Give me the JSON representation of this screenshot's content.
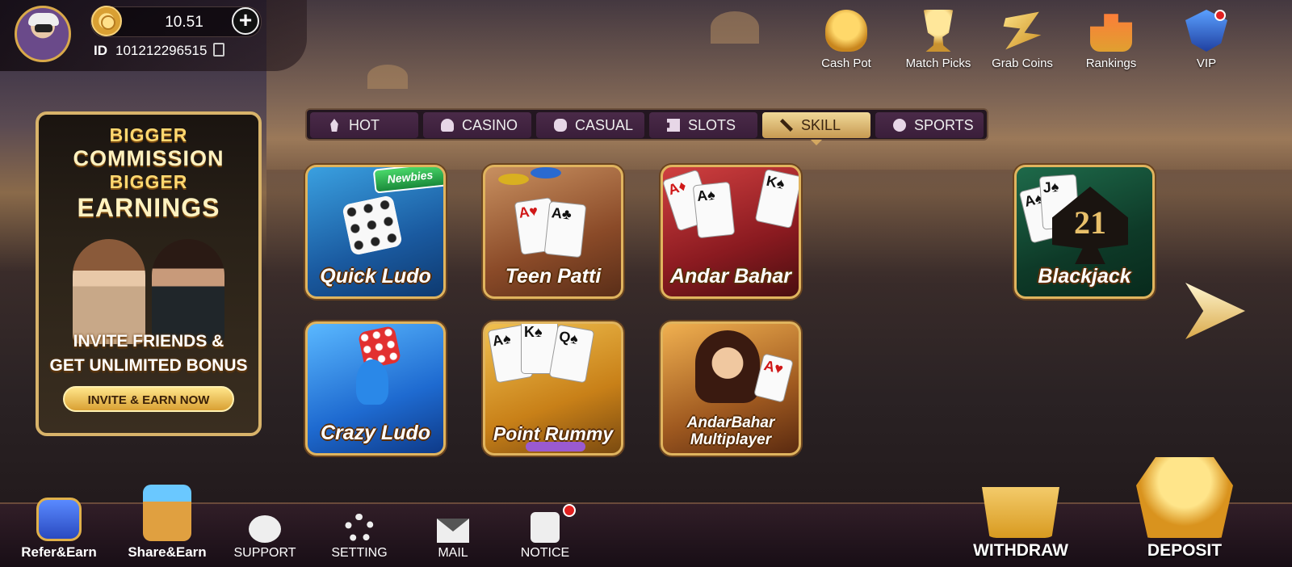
{
  "profile": {
    "balance": "10.51",
    "id_label": "ID",
    "id_value": "101212296515"
  },
  "features": [
    {
      "label": "Cash Pot",
      "icon": "lucky-cat-icon"
    },
    {
      "label": "Match Picks",
      "icon": "trophy-icon"
    },
    {
      "label": "Grab Coins",
      "icon": "grab-coins-icon"
    },
    {
      "label": "Rankings",
      "icon": "podium-icon"
    },
    {
      "label": "VIP",
      "icon": "vip-shield-icon"
    }
  ],
  "promo": {
    "line1": "BIGGER",
    "line2": "COMMISSION",
    "line3": "BIGGER",
    "line4": "EARNINGS",
    "invite_line1": "INVITE FRIENDS &",
    "invite_line2": "GET UNLIMITED BONUS",
    "button": "INVITE & EARN NOW"
  },
  "tabs": [
    {
      "label": "HOT",
      "icon": "fire-icon",
      "active": false
    },
    {
      "label": "CASINO",
      "icon": "dealer-icon",
      "active": false
    },
    {
      "label": "CASUAL",
      "icon": "gamepad-icon",
      "active": false
    },
    {
      "label": "SLOTS",
      "icon": "slot-machine-icon",
      "active": false
    },
    {
      "label": "SKILL",
      "icon": "swords-icon",
      "active": true
    },
    {
      "label": "SPORTS",
      "icon": "ball-icon",
      "active": false
    }
  ],
  "games": {
    "quick_ludo": {
      "name": "Quick Ludo",
      "badge": "Newbies"
    },
    "teen_patti": {
      "name": "Teen Patti"
    },
    "andar_bahar": {
      "name": "Andar Bahar"
    },
    "blackjack": {
      "name": "Blackjack",
      "emblem": "21"
    },
    "crazy_ludo": {
      "name": "Crazy Ludo"
    },
    "point_rummy": {
      "name": "Point Rummy"
    },
    "andar_bahar_multi": {
      "name_line1": "AndarBahar",
      "name_line2": "Multiplayer"
    }
  },
  "bottom": {
    "refer": "Refer&Earn",
    "share": "Share&Earn",
    "support": "SUPPORT",
    "setting": "SETTING",
    "mail": "MAIL",
    "notice": "NOTICE",
    "withdraw": "WITHDRAW",
    "deposit": "DEPOSIT"
  },
  "colors": {
    "gold_border": "#e0b45e",
    "active_tab": "#d9b26a",
    "tab_bg": "#3a1e3a",
    "notification_dot": "#e02020"
  }
}
